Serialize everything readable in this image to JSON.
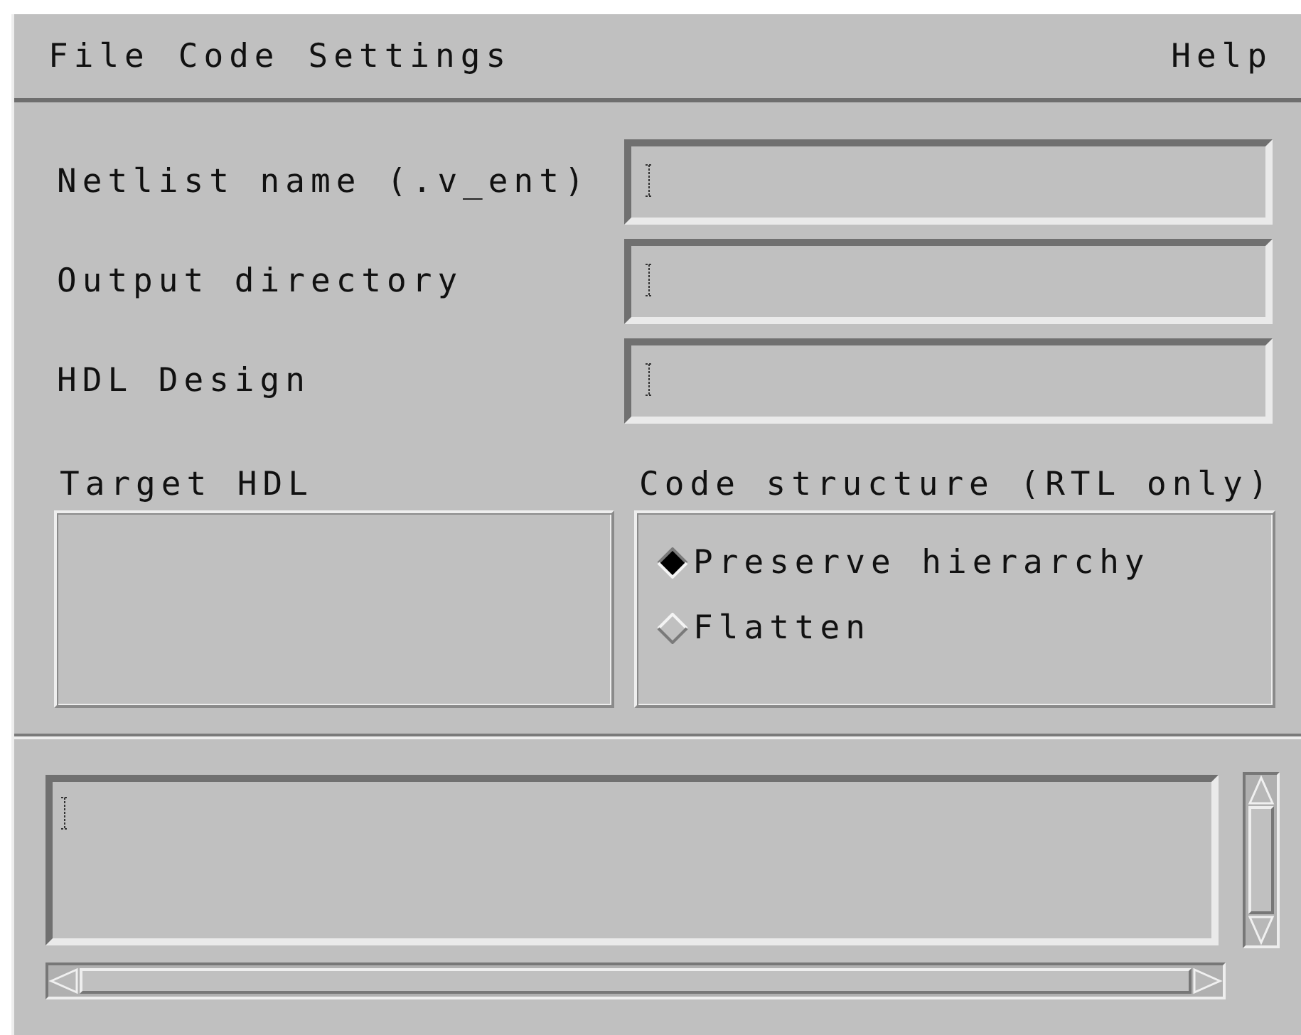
{
  "menu": {
    "items": [
      "File",
      "Code",
      "Settings"
    ],
    "help": "Help"
  },
  "fields": [
    {
      "label": "Netlist name (.v_ent)"
    },
    {
      "label": "Output directory"
    },
    {
      "label": "HDL Design"
    }
  ],
  "target_hdl": {
    "title": "Target HDL"
  },
  "code_structure": {
    "title": "Code structure (RTL only)",
    "options": [
      {
        "label": "Preserve hierarchy",
        "selected": true
      },
      {
        "label": "Flatten",
        "selected": false
      }
    ]
  }
}
